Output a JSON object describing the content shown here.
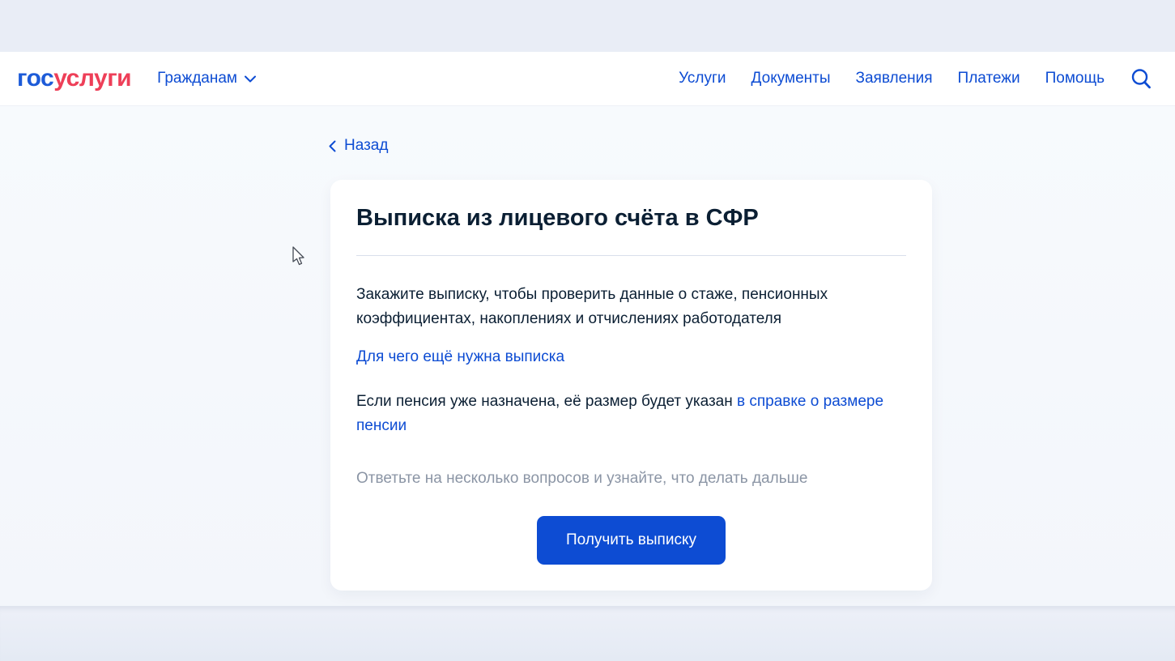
{
  "header": {
    "logo": {
      "part1": "гос",
      "part2": "услуги"
    },
    "audience": {
      "label": "Гражданам"
    },
    "nav": [
      {
        "label": "Услуги"
      },
      {
        "label": "Документы"
      },
      {
        "label": "Заявления"
      },
      {
        "label": "Платежи"
      },
      {
        "label": "Помощь"
      }
    ],
    "search_icon": "magnifier"
  },
  "page": {
    "back_link": {
      "label": "Назад"
    },
    "card": {
      "title": "Выписка из лицевого счёта в СФР",
      "description": "Закажите выписку, чтобы проверить данные о стаже, пенсионных коэффициентах, накоплениях и отчислениях работодателя",
      "more_link": "Для чего ещё нужна выписка",
      "pension_note_prefix": "Если пенсия уже назначена, её размер будет указан ",
      "pension_note_link": "в справке о размере пенсии",
      "hint": "Ответьте на несколько вопросов и узнайте, что делать дальше",
      "submit_button": "Получить выписку"
    }
  },
  "colors": {
    "link_blue": "#0d4cd3",
    "logo_blue": "#1d5bd8",
    "logo_red": "#ee3f58",
    "text_dark": "#0b1f33",
    "hint_gray": "#8b95a5",
    "top_strip": "#e9edf6",
    "card_bg": "#ffffff"
  }
}
